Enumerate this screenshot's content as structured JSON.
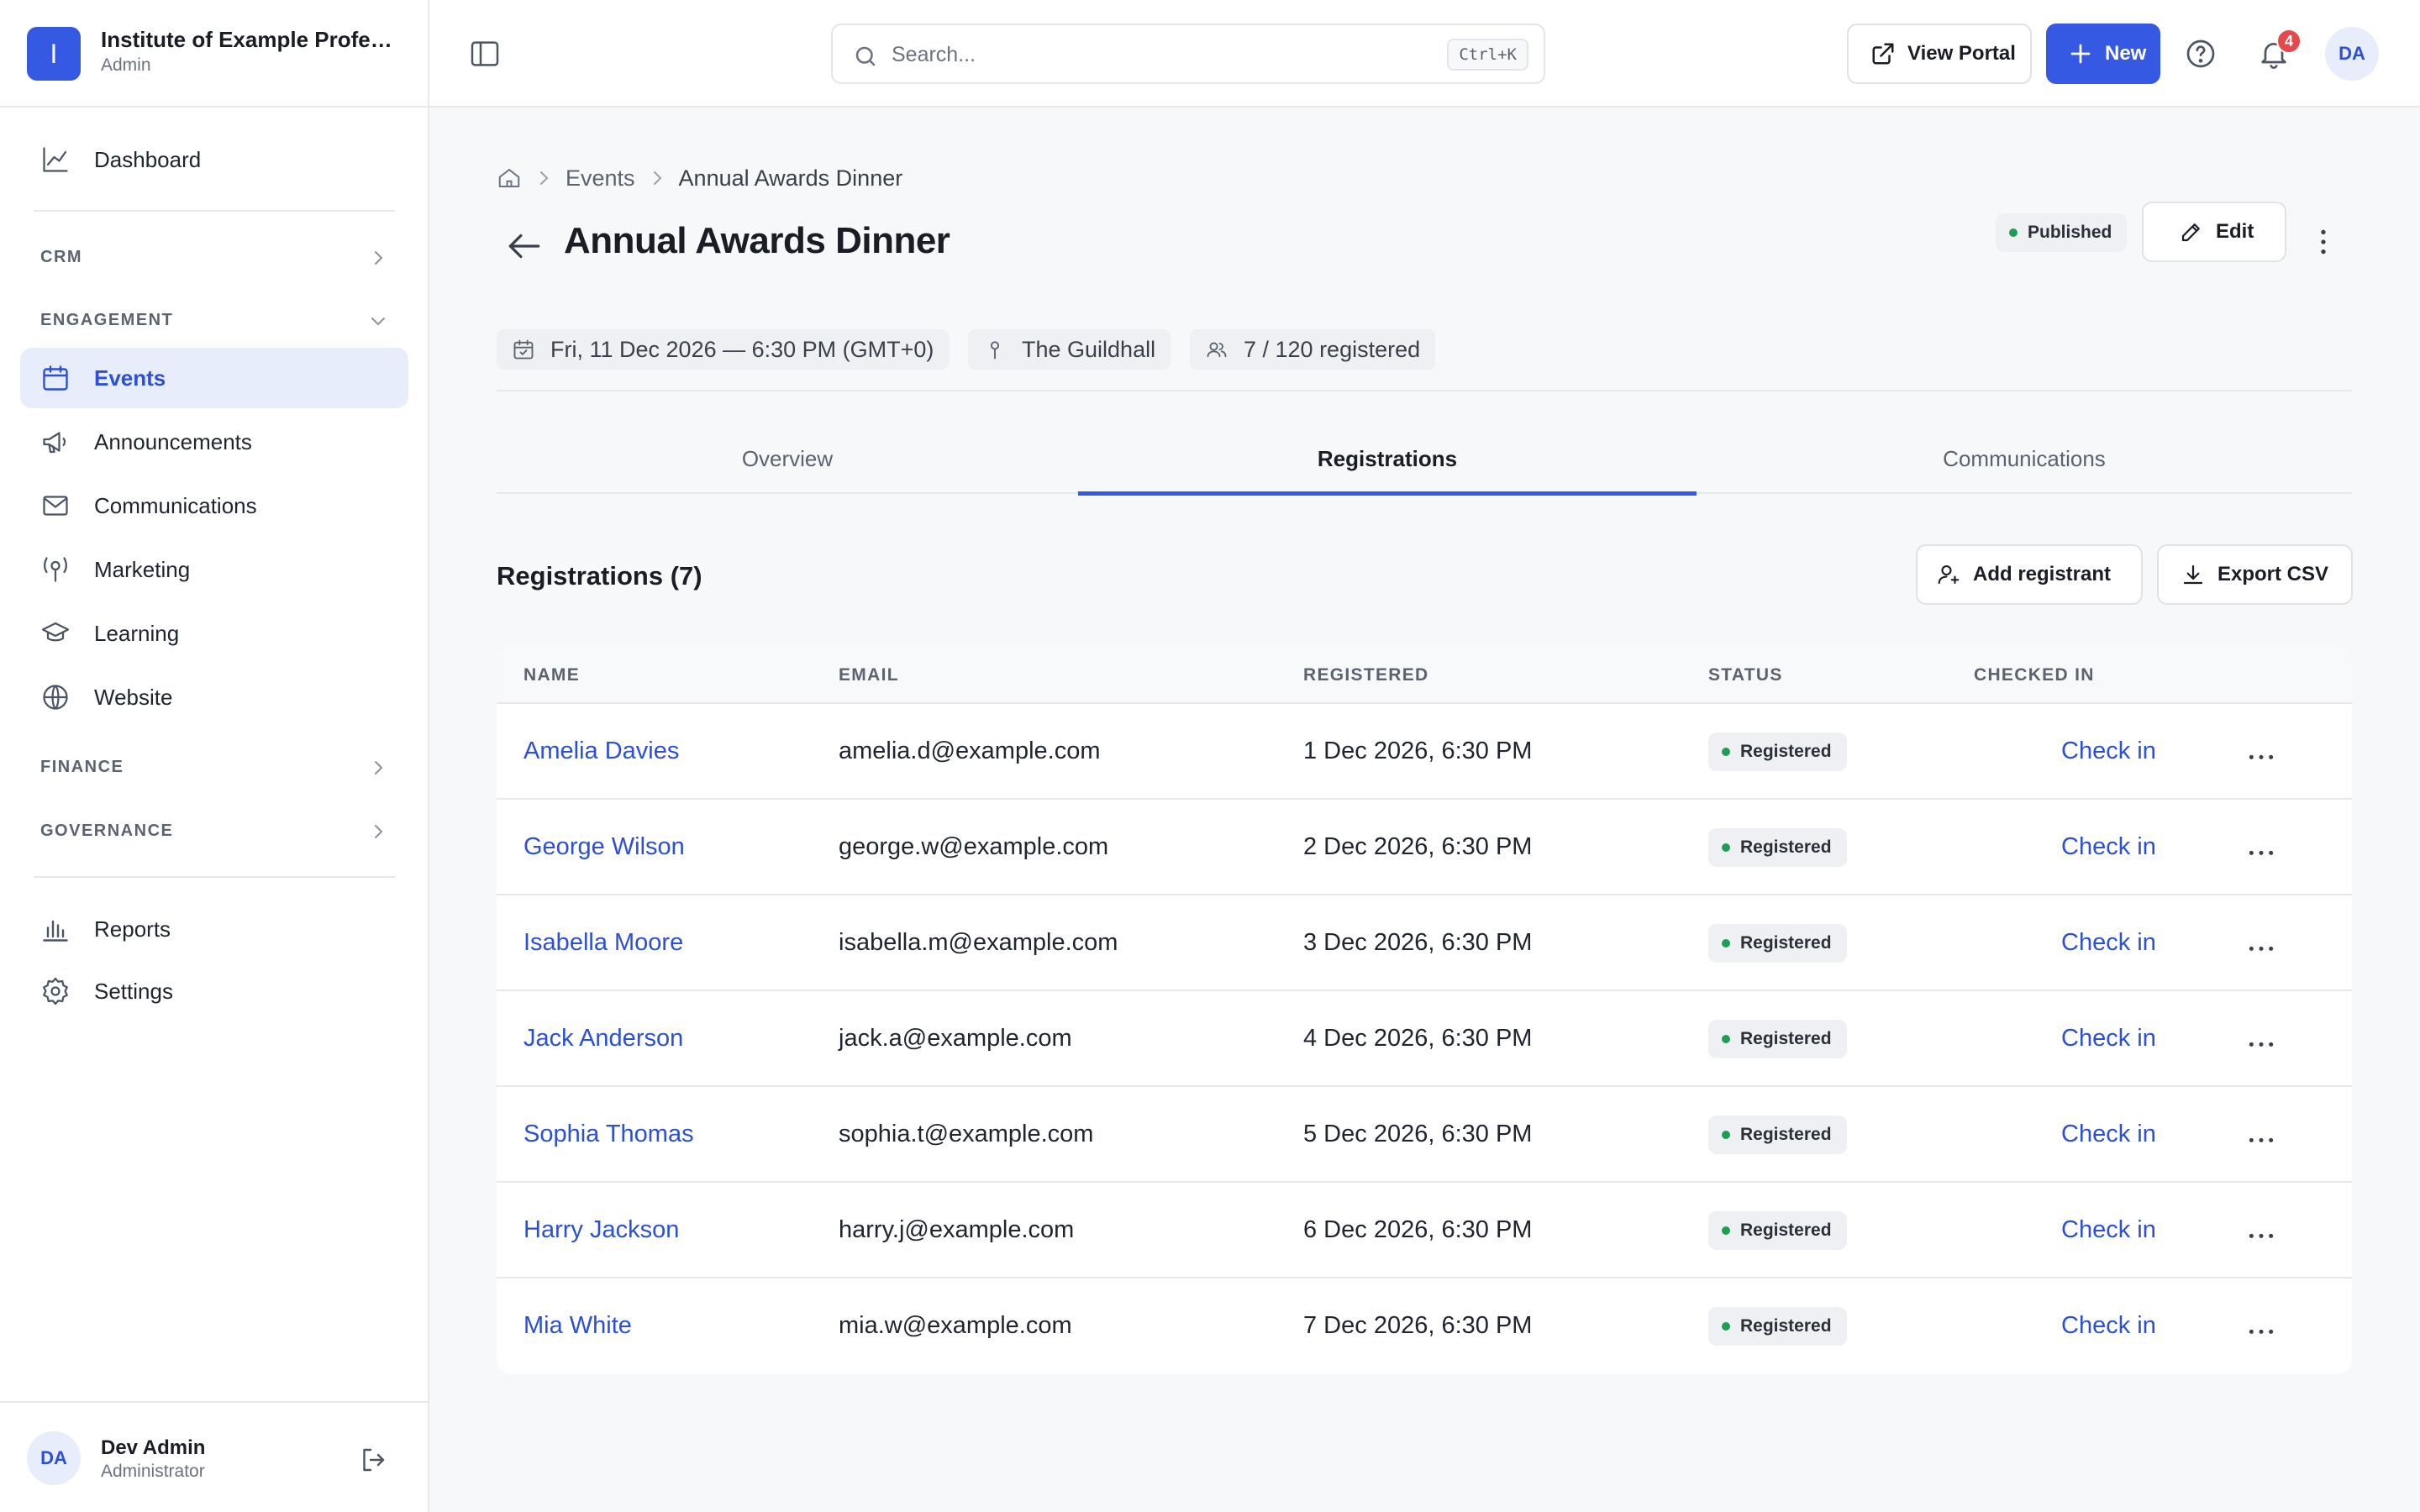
{
  "org": {
    "logo_letter": "I",
    "name": "Institute of Example Professi…",
    "role": "Admin"
  },
  "sidebar": {
    "dashboard": "Dashboard",
    "sections": {
      "crm": "CRM",
      "engagement": "ENGAGEMENT",
      "finance": "FINANCE",
      "governance": "GOVERNANCE"
    },
    "engagement_items": [
      {
        "label": "Events",
        "icon": "calendar-icon",
        "active": true
      },
      {
        "label": "Announcements",
        "icon": "megaphone-icon"
      },
      {
        "label": "Communications",
        "icon": "mail-icon"
      },
      {
        "label": "Marketing",
        "icon": "marketing-icon"
      },
      {
        "label": "Learning",
        "icon": "graduation-cap-icon"
      },
      {
        "label": "Website",
        "icon": "globe-icon"
      }
    ],
    "reports": "Reports",
    "settings": "Settings"
  },
  "user": {
    "initials": "DA",
    "name": "Dev Admin",
    "role": "Administrator"
  },
  "topbar": {
    "search_placeholder": "Search...",
    "search_shortcut": "Ctrl+K",
    "view_portal": "View Portal",
    "new": "New",
    "notification_count": "4",
    "avatar_initials": "DA"
  },
  "breadcrumb": {
    "events": "Events",
    "current": "Annual Awards Dinner"
  },
  "event": {
    "title": "Annual Awards Dinner",
    "status": "Published",
    "edit": "Edit",
    "date": "Fri, 11 Dec 2026 — 6:30 PM (GMT+0)",
    "venue": "The Guildhall",
    "registered": "7 / 120 registered"
  },
  "tabs": {
    "overview": "Overview",
    "registrations": "Registrations",
    "communications": "Communications"
  },
  "registrations": {
    "title": "Registrations (7)",
    "add_button": "Add registrant",
    "export_button": "Export CSV",
    "columns": {
      "name": "NAME",
      "email": "EMAIL",
      "registered": "REGISTERED",
      "status": "STATUS",
      "checked_in": "CHECKED IN"
    },
    "rows": [
      {
        "name": "Amelia Davies",
        "email": "amelia.d@example.com",
        "registered": "1 Dec 2026, 6:30 PM",
        "status": "Registered",
        "action": "Check in"
      },
      {
        "name": "George Wilson",
        "email": "george.w@example.com",
        "registered": "2 Dec 2026, 6:30 PM",
        "status": "Registered",
        "action": "Check in"
      },
      {
        "name": "Isabella Moore",
        "email": "isabella.m@example.com",
        "registered": "3 Dec 2026, 6:30 PM",
        "status": "Registered",
        "action": "Check in"
      },
      {
        "name": "Jack Anderson",
        "email": "jack.a@example.com",
        "registered": "4 Dec 2026, 6:30 PM",
        "status": "Registered",
        "action": "Check in"
      },
      {
        "name": "Sophia Thomas",
        "email": "sophia.t@example.com",
        "registered": "5 Dec 2026, 6:30 PM",
        "status": "Registered",
        "action": "Check in"
      },
      {
        "name": "Harry Jackson",
        "email": "harry.j@example.com",
        "registered": "6 Dec 2026, 6:30 PM",
        "status": "Registered",
        "action": "Check in"
      },
      {
        "name": "Mia White",
        "email": "mia.w@example.com",
        "registered": "7 Dec 2026, 6:30 PM",
        "status": "Registered",
        "action": "Check in"
      }
    ]
  },
  "colors": {
    "accent": "#3659e3",
    "link": "#2b4fd8",
    "success": "#1f9d55",
    "danger": "#e5484d"
  }
}
